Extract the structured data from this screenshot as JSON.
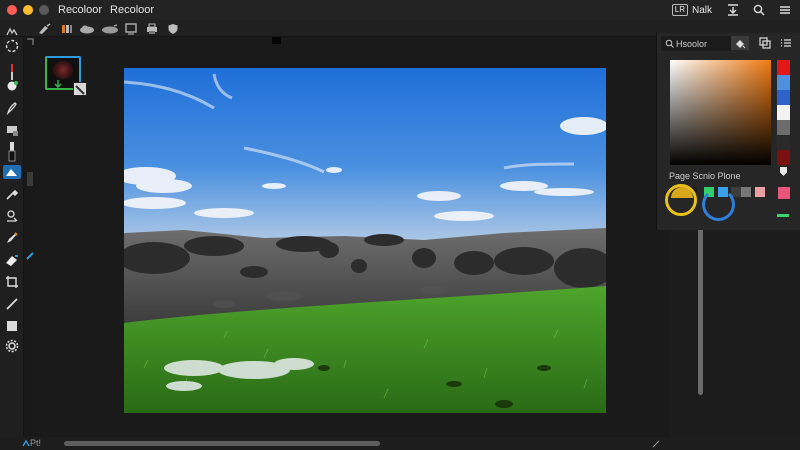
{
  "window": {
    "title": "Recoloor",
    "document_title": "Recoloor"
  },
  "title_bar": {
    "user_badge": "LR",
    "user_name": "Nalk"
  },
  "status_bar": {
    "text": "Pt!"
  },
  "color_panel": {
    "search_value": "Hsoolor",
    "palette_label": "Page Scnio Plone",
    "hue_strip": [
      "#e01818",
      "#4f8fe0",
      "#2f62c8",
      "#f2f2f2",
      "#6c6c6c",
      "#2a2a2a",
      "#7a1010"
    ],
    "swatches": [
      "#1e1e1e",
      "#2fd06a",
      "#3aa0e8",
      "#3c3c3c",
      "#777777",
      "#e9a0a0"
    ],
    "accent_color": "#e8557a"
  },
  "colors": {
    "accent_blue": "#1f6fb5",
    "ring_yellow": "#e8c21a",
    "ring_blue": "#2f7fd8"
  },
  "icons": {
    "toolbar": [
      "move-icon",
      "lasso-icon",
      "brush-icon",
      "pen-icon",
      "gradient-icon",
      "eraser-icon",
      "selection-fill-icon",
      "eyedropper-icon",
      "clone-stamp-icon",
      "pencil-icon",
      "heal-icon",
      "crop-icon",
      "picker-icon",
      "square-icon",
      "settings-icon"
    ]
  }
}
